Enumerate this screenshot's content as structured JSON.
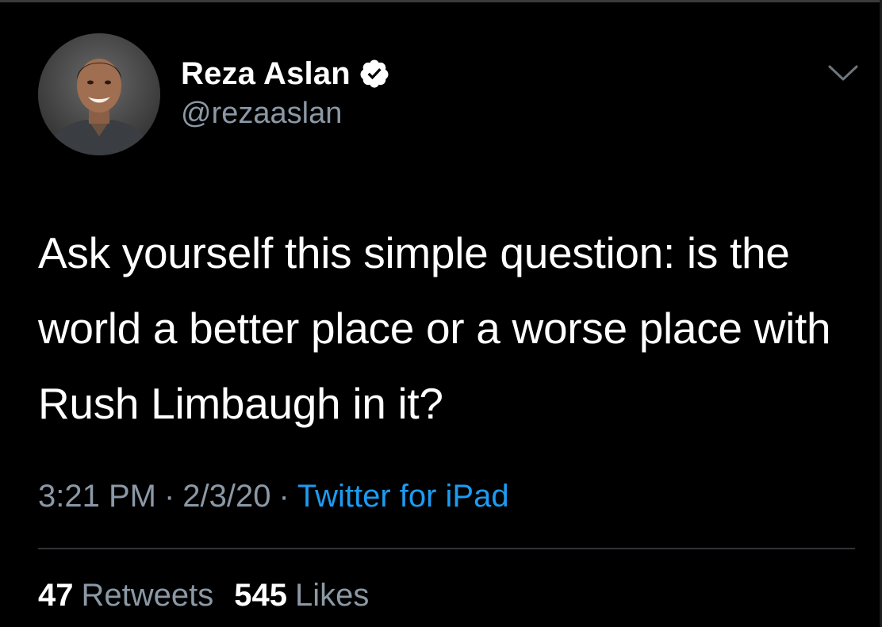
{
  "author": {
    "display_name": "Reza Aslan",
    "handle": "@rezaaslan",
    "verified": true,
    "avatar_icon": "profile-photo"
  },
  "tweet": {
    "text": "Ask yourself this simple question: is the world a better place or a worse place with Rush Limbaugh in it?",
    "time": "3:21 PM",
    "separator": "·",
    "date": "2/3/20",
    "source": "Twitter for iPad"
  },
  "stats": {
    "retweets_count": "47",
    "retweets_label": "Retweets",
    "likes_count": "545",
    "likes_label": "Likes"
  },
  "icons": {
    "verified": "verified-badge-icon",
    "menu": "chevron-down-icon"
  },
  "colors": {
    "background": "#000000",
    "primary_text": "#ffffff",
    "secondary_text": "#8b98a5",
    "link": "#1d9bf0",
    "divider": "#2f3336"
  }
}
